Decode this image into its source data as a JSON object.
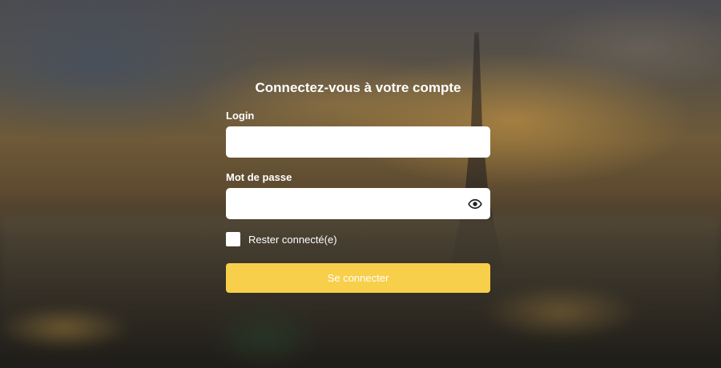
{
  "login_form": {
    "title": "Connectez-vous à votre compte",
    "login_label": "Login",
    "login_value": "",
    "password_label": "Mot de passe",
    "password_value": "",
    "password_toggle_icon": "eye-icon",
    "remember_label": "Rester connecté(e)",
    "remember_checked": false,
    "submit_label": "Se connecter"
  },
  "colors": {
    "button": "#f7cf4b",
    "text": "#ffffff",
    "input_bg": "#ffffff"
  }
}
